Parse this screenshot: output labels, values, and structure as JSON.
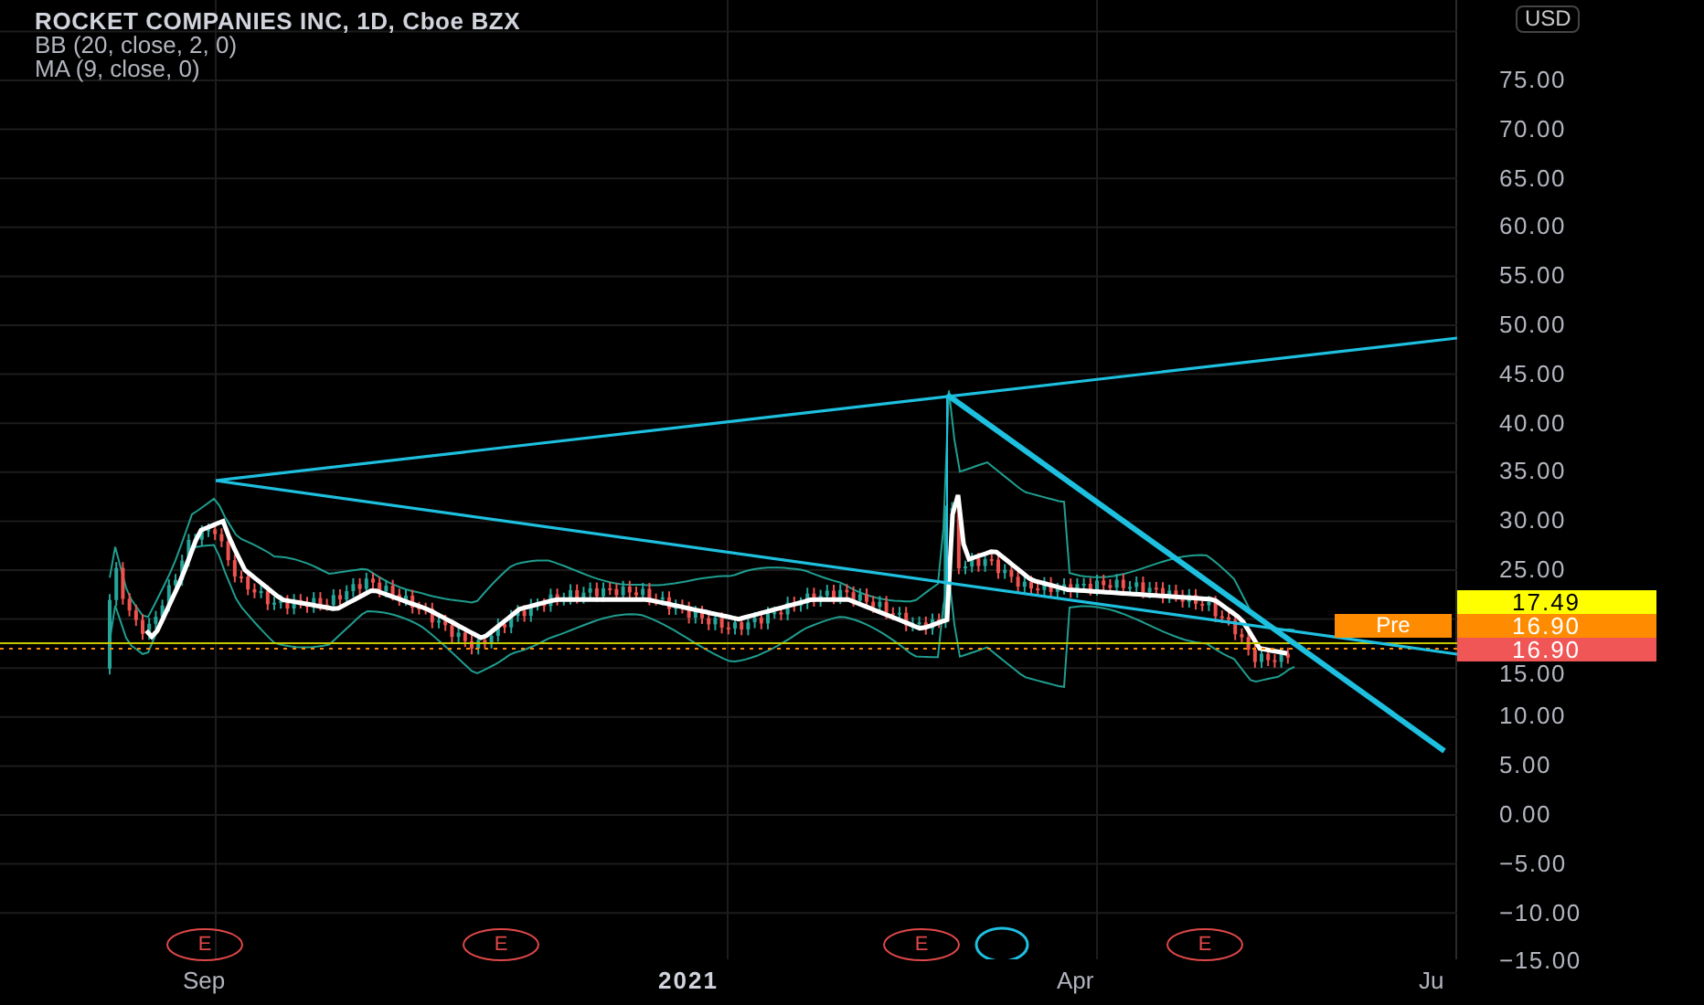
{
  "legend": {
    "title": "ROCKET COMPANIES INC, 1D, Cboe BZX",
    "indicators": [
      "BB (20, close, 2, 0)",
      "MA (9, close, 0)"
    ]
  },
  "price_axis": {
    "currency": "USD",
    "ticks": [
      "75.00",
      "70.00",
      "65.00",
      "60.00",
      "55.00",
      "50.00",
      "45.00",
      "40.00",
      "35.00",
      "30.00",
      "25.00",
      "15.00",
      "10.00",
      "5.00",
      "0.00",
      "−5.00",
      "−10.00",
      "−15.00"
    ]
  },
  "price_tags": [
    {
      "kind": "last",
      "value": "17.49",
      "color": "#ffff00"
    },
    {
      "kind": "pre",
      "label": "Pre",
      "value": "16.90",
      "color": "#ff8c00"
    },
    {
      "kind": "close",
      "value": "16.90",
      "color": "#f05656"
    }
  ],
  "events": [
    {
      "label": "E"
    },
    {
      "label": "E"
    },
    {
      "label": "E"
    },
    {
      "label": "E"
    }
  ],
  "time_axis": {
    "labels": [
      {
        "text": "Sep",
        "bold": false
      },
      {
        "text": "2021",
        "bold": true
      },
      {
        "text": "Apr",
        "bold": false
      },
      {
        "text": "Ju",
        "bold": false
      }
    ]
  }
}
